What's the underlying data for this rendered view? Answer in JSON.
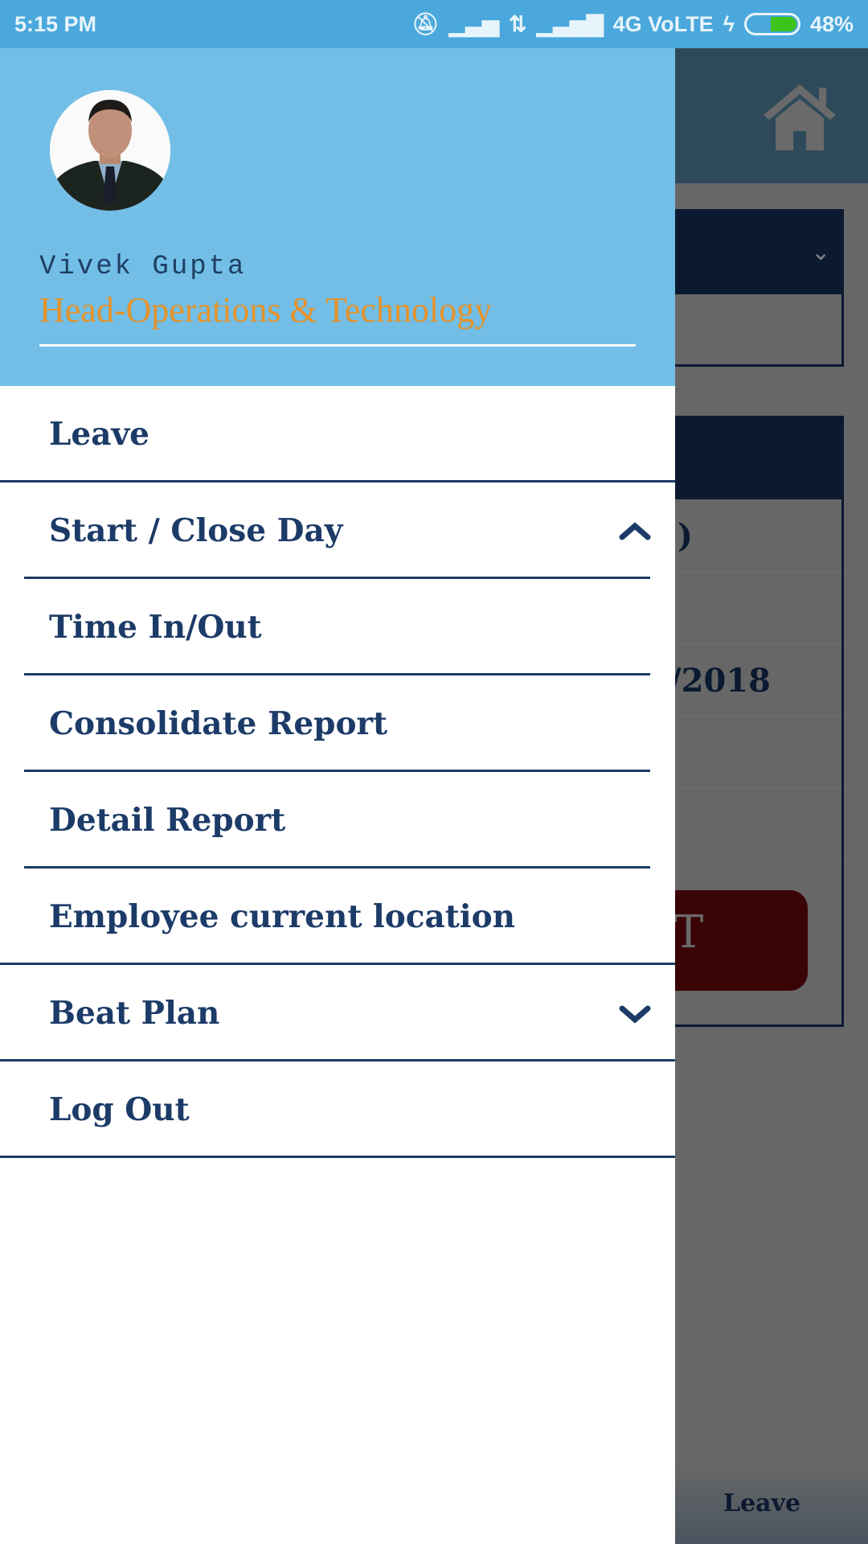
{
  "status_bar": {
    "time": "5:15 PM",
    "network": "4G VoLTE",
    "battery": "48%",
    "battery_level": 48
  },
  "profile": {
    "name": "Vivek Gupta",
    "role": "Head-Operations & Technology"
  },
  "menu": [
    {
      "label": "Leave",
      "icon": null
    },
    {
      "label": "Start / Close Day",
      "icon": "chevron-up-icon"
    },
    {
      "label": "Time In/Out",
      "icon": null
    },
    {
      "label": "Consolidate Report",
      "icon": null
    },
    {
      "label": "Detail Report",
      "icon": null
    },
    {
      "label": "Employee current location",
      "icon": null
    },
    {
      "label": "Beat Plan",
      "icon": "chevron-down-icon"
    },
    {
      "label": "Log Out",
      "icon": null
    }
  ],
  "background": {
    "row1_text": ")",
    "row3_text": "/2018",
    "button_text": "T",
    "bottom_tab": "Leave"
  },
  "colors": {
    "status_bar": "#4aa8dc",
    "drawer_header": "#72bee6",
    "menu_text": "#1c3b68",
    "role_text": "#e5922a",
    "button": "#3a0306"
  }
}
